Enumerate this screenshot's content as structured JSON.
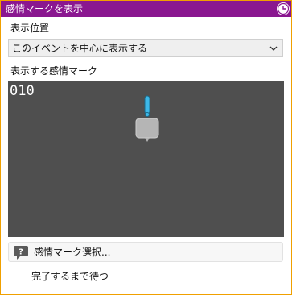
{
  "window": {
    "title": "感情マークを表示"
  },
  "position": {
    "label": "表示位置",
    "selected": "このイベントを中心に表示する"
  },
  "balloon": {
    "label": "表示する感情マーク",
    "frame_number": "010"
  },
  "select_button": {
    "label": "感情マーク選択..."
  },
  "wait_option": {
    "label": "完了するまで待つ",
    "checked": false
  },
  "colors": {
    "titlebar": "#8a1790",
    "border": "#f0a000",
    "preview_bg": "#4f4f4f"
  }
}
